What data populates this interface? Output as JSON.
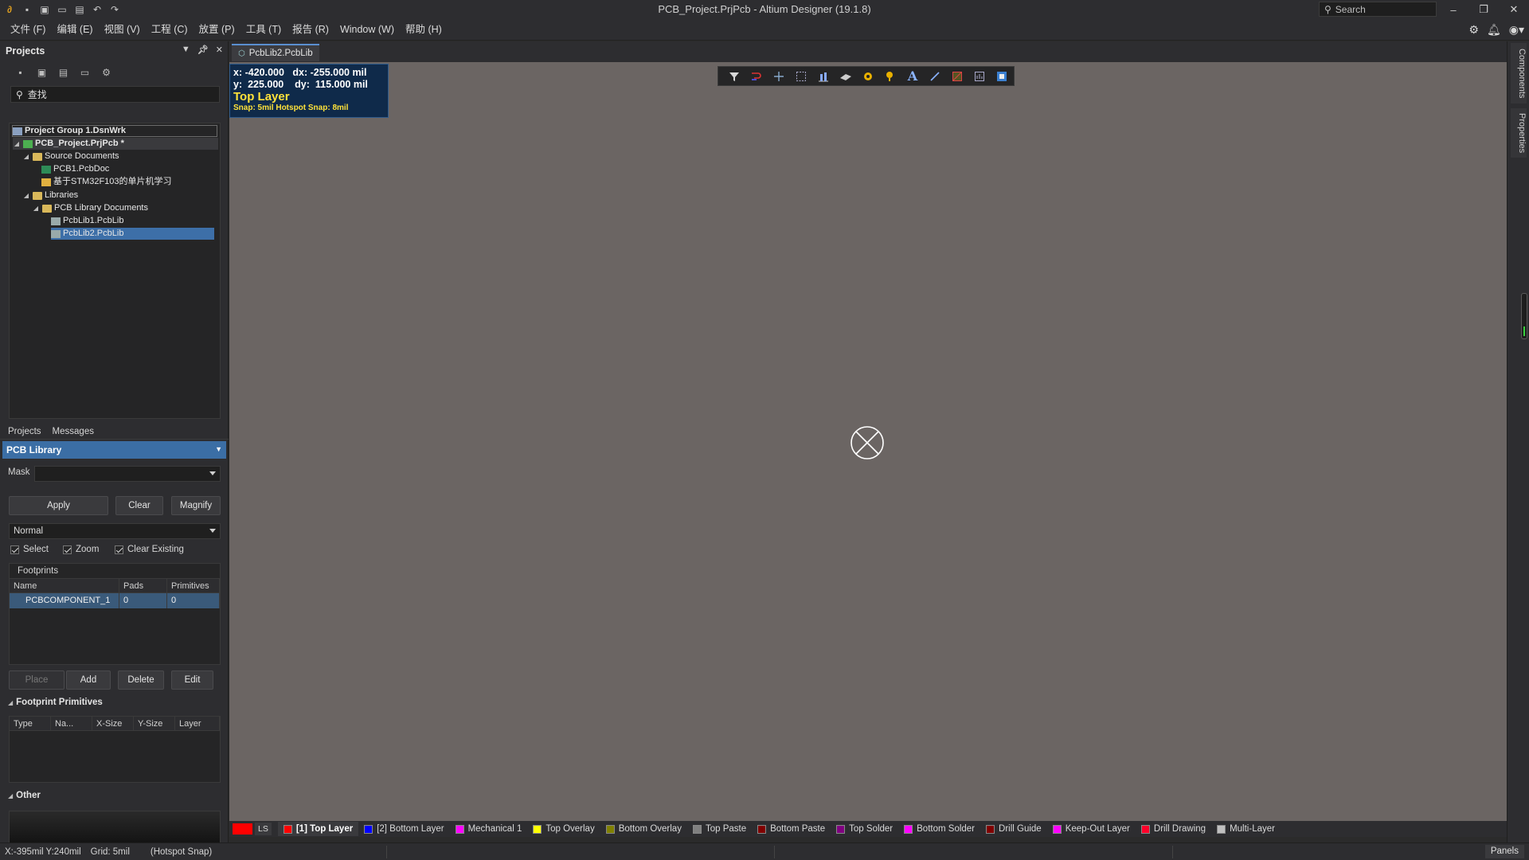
{
  "window": {
    "title": "PCB_Project.PrjPcb - Altium Designer (19.1.8)",
    "search_placeholder": "Search"
  },
  "menu": [
    "文件 (F)",
    "编辑 (E)",
    "视图 (V)",
    "工程 (C)",
    "放置 (P)",
    "工具 (T)",
    "报告 (R)",
    "Window (W)",
    "帮助 (H)"
  ],
  "projects_panel": {
    "title": "Projects",
    "search_placeholder": "查找",
    "tree": {
      "group": "Project Group 1.DsnWrk",
      "project": "PCB_Project.PrjPcb *",
      "source_docs": "Source Documents",
      "pcb_doc": "PCB1.PcbDoc",
      "sch_doc": "基于STM32F103的单片机学习",
      "libraries": "Libraries",
      "pcb_lib_docs": "PCB Library Documents",
      "lib1": "PcbLib1.PcbLib",
      "lib2": "PcbLib2.PcbLib"
    },
    "tabs": [
      "Projects",
      "Messages"
    ]
  },
  "pcb_library": {
    "title": "PCB Library",
    "mask_label": "Mask",
    "mask_value": "",
    "apply": "Apply",
    "clear": "Clear",
    "magnify": "Magnify",
    "mode": "Normal",
    "select": "Select",
    "zoom": "Zoom",
    "clear_existing": "Clear Existing",
    "footprints_label": "Footprints",
    "columns": [
      "Name",
      "Pads",
      "Primitives"
    ],
    "rows": [
      {
        "name": "PCBCOMPONENT_1",
        "pads": "0",
        "primitives": "0"
      }
    ],
    "place": "Place",
    "add": "Add",
    "delete": "Delete",
    "edit": "Edit",
    "primitives_title": "Footprint Primitives",
    "prim_columns": [
      "Type",
      "Na...",
      "X-Size",
      "Y-Size",
      "Layer"
    ],
    "other_title": "Other"
  },
  "doc_tab": "PcbLib2.PcbLib",
  "hud": {
    "x_label": "x:",
    "x_value": "-420.000",
    "dx_label": "dx:",
    "dx_value": "-255.000 mil",
    "y_label": "y:",
    "y_value": "225.000",
    "dy_label": "dy:",
    "dy_value": "115.000 mil",
    "layer": "Top Layer",
    "snap": "Snap: 5mil Hotspot Snap: 8mil"
  },
  "side_tabs": [
    "Components",
    "Properties"
  ],
  "layers": {
    "ls": "LS",
    "items": [
      {
        "label": "[1] Top Layer",
        "color": "#ff0000",
        "active": true
      },
      {
        "label": "[2] Bottom Layer",
        "color": "#0000ff",
        "active": false
      },
      {
        "label": "Mechanical 1",
        "color": "#ff00ff",
        "active": false
      },
      {
        "label": "Top Overlay",
        "color": "#ffff00",
        "active": false
      },
      {
        "label": "Bottom Overlay",
        "color": "#808000",
        "active": false
      },
      {
        "label": "Top Paste",
        "color": "#808080",
        "active": false
      },
      {
        "label": "Bottom Paste",
        "color": "#800000",
        "active": false
      },
      {
        "label": "Top Solder",
        "color": "#800080",
        "active": false
      },
      {
        "label": "Bottom Solder",
        "color": "#ff00ff",
        "active": false
      },
      {
        "label": "Drill Guide",
        "color": "#800000",
        "active": false
      },
      {
        "label": "Keep-Out Layer",
        "color": "#ff00ff",
        "active": false
      },
      {
        "label": "Drill Drawing",
        "color": "#ff002a",
        "active": false
      },
      {
        "label": "Multi-Layer",
        "color": "#c0c0c0",
        "active": false
      }
    ]
  },
  "status": {
    "coords": "X:-395mil Y:240mil",
    "grid": "Grid: 5mil",
    "snap": "(Hotspot Snap)",
    "panels": "Panels"
  }
}
